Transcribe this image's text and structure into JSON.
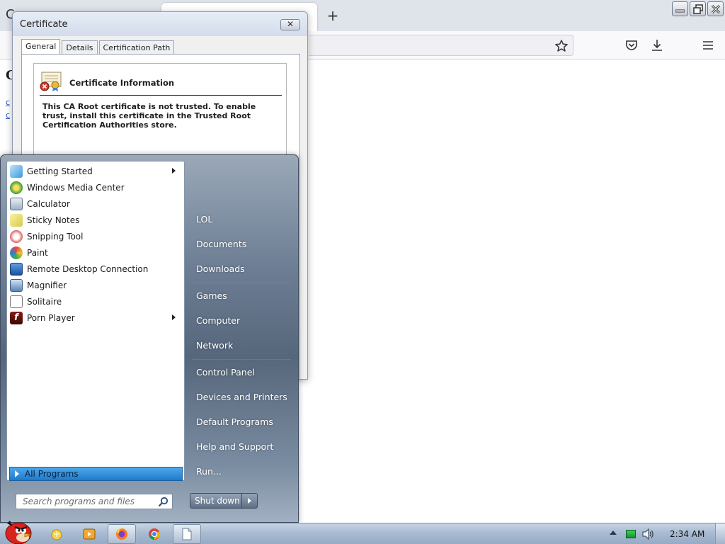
{
  "certificate_dialog": {
    "title": "Certificate",
    "close_label": "✕",
    "tabs": [
      "General",
      "Details",
      "Certification Path"
    ],
    "info_title": "Certificate Information",
    "warning_text": "This CA Root certificate is not trusted. To enable trust, install this certificate in the Trusted Root Certification Authorities store."
  },
  "browser": {
    "new_tab_label": "+",
    "logo_hint": "C",
    "link_1": "c",
    "link_2": "c"
  },
  "start_menu": {
    "programs": [
      {
        "label": "Getting Started",
        "icon": "getting-started-icon",
        "has_submenu": true
      },
      {
        "label": "Windows Media Center",
        "icon": "media-center-icon",
        "has_submenu": false
      },
      {
        "label": "Calculator",
        "icon": "calculator-icon",
        "has_submenu": false
      },
      {
        "label": "Sticky Notes",
        "icon": "sticky-notes-icon",
        "has_submenu": false
      },
      {
        "label": "Snipping Tool",
        "icon": "snipping-tool-icon",
        "has_submenu": false
      },
      {
        "label": "Paint",
        "icon": "paint-icon",
        "has_submenu": false
      },
      {
        "label": "Remote Desktop Connection",
        "icon": "remote-desktop-icon",
        "has_submenu": false
      },
      {
        "label": "Magnifier",
        "icon": "magnifier-icon",
        "has_submenu": false
      },
      {
        "label": "Solitaire",
        "icon": "solitaire-icon",
        "has_submenu": false
      },
      {
        "label": "Porn Player",
        "icon": "flash-player-icon",
        "has_submenu": true
      }
    ],
    "all_programs_label": "All Programs",
    "search_placeholder": "Search programs and files",
    "places": [
      "LOL",
      "Documents",
      "Downloads",
      "Games",
      "Computer",
      "Network",
      "Control Panel",
      "Devices and Printers",
      "Default Programs",
      "Help and Support",
      "Run..."
    ],
    "shutdown_label": "Shut down"
  },
  "taskbar": {
    "clock": "2:34 AM"
  }
}
